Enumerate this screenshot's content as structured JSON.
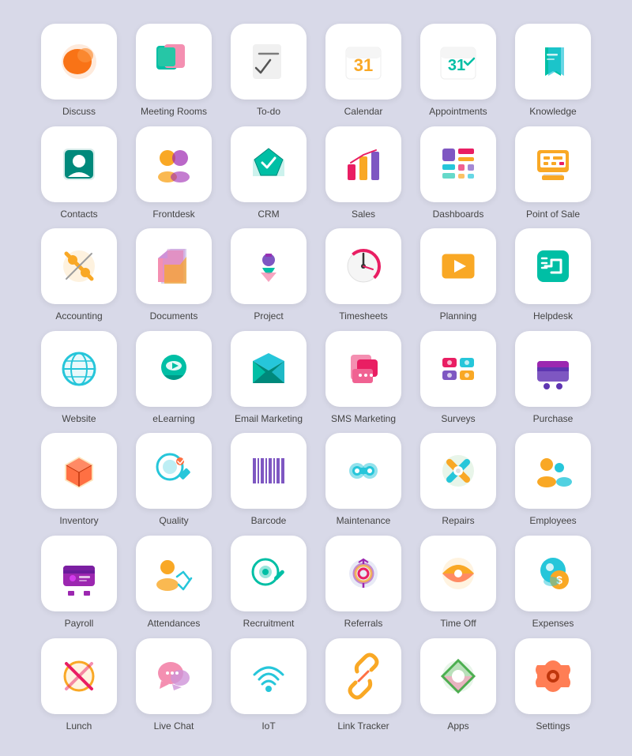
{
  "apps": [
    {
      "id": "discuss",
      "label": "Discuss"
    },
    {
      "id": "meeting-rooms",
      "label": "Meeting Rooms"
    },
    {
      "id": "to-do",
      "label": "To-do"
    },
    {
      "id": "calendar",
      "label": "Calendar"
    },
    {
      "id": "appointments",
      "label": "Appointments"
    },
    {
      "id": "knowledge",
      "label": "Knowledge"
    },
    {
      "id": "contacts",
      "label": "Contacts"
    },
    {
      "id": "frontdesk",
      "label": "Frontdesk"
    },
    {
      "id": "crm",
      "label": "CRM"
    },
    {
      "id": "sales",
      "label": "Sales"
    },
    {
      "id": "dashboards",
      "label": "Dashboards"
    },
    {
      "id": "point-of-sale",
      "label": "Point of Sale"
    },
    {
      "id": "accounting",
      "label": "Accounting"
    },
    {
      "id": "documents",
      "label": "Documents"
    },
    {
      "id": "project",
      "label": "Project"
    },
    {
      "id": "timesheets",
      "label": "Timesheets"
    },
    {
      "id": "planning",
      "label": "Planning"
    },
    {
      "id": "helpdesk",
      "label": "Helpdesk"
    },
    {
      "id": "website",
      "label": "Website"
    },
    {
      "id": "elearning",
      "label": "eLearning"
    },
    {
      "id": "email-marketing",
      "label": "Email Marketing"
    },
    {
      "id": "sms-marketing",
      "label": "SMS Marketing"
    },
    {
      "id": "surveys",
      "label": "Surveys"
    },
    {
      "id": "purchase",
      "label": "Purchase"
    },
    {
      "id": "inventory",
      "label": "Inventory"
    },
    {
      "id": "quality",
      "label": "Quality"
    },
    {
      "id": "barcode",
      "label": "Barcode"
    },
    {
      "id": "maintenance",
      "label": "Maintenance"
    },
    {
      "id": "repairs",
      "label": "Repairs"
    },
    {
      "id": "employees",
      "label": "Employees"
    },
    {
      "id": "payroll",
      "label": "Payroll"
    },
    {
      "id": "attendances",
      "label": "Attendances"
    },
    {
      "id": "recruitment",
      "label": "Recruitment"
    },
    {
      "id": "referrals",
      "label": "Referrals"
    },
    {
      "id": "time-off",
      "label": "Time Off"
    },
    {
      "id": "expenses",
      "label": "Expenses"
    },
    {
      "id": "lunch",
      "label": "Lunch"
    },
    {
      "id": "live-chat",
      "label": "Live Chat"
    },
    {
      "id": "iot",
      "label": "IoT"
    },
    {
      "id": "link-tracker",
      "label": "Link Tracker"
    },
    {
      "id": "apps",
      "label": "Apps"
    },
    {
      "id": "settings",
      "label": "Settings"
    }
  ]
}
